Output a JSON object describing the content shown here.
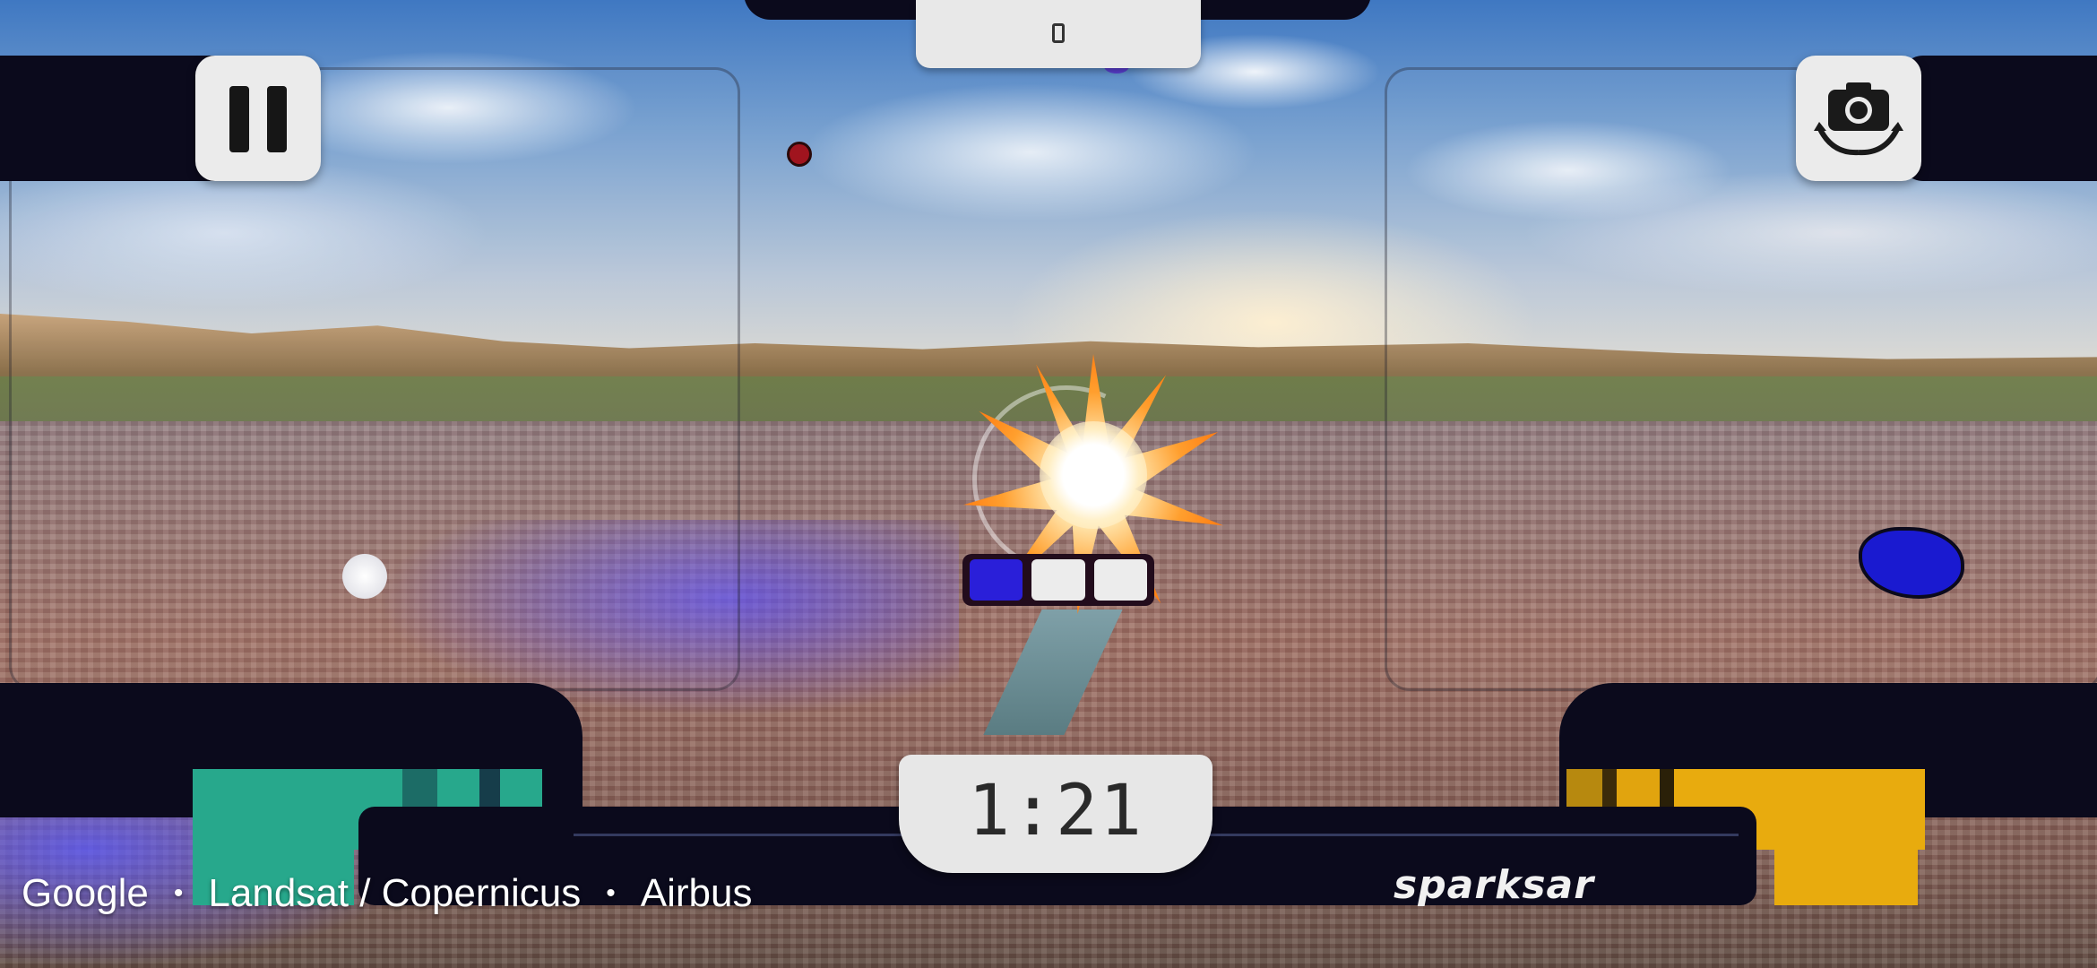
{
  "hud": {
    "timer": "1:21",
    "brand": "sparksar",
    "pause_icon": "pause-icon",
    "camera_icon": "camera-rotate-icon",
    "notch_icon": "phone-icon",
    "round_progress": [
      true,
      false,
      false
    ]
  },
  "attribution": {
    "items": [
      "Google",
      "Landsat / Copernicus",
      "Airbus"
    ],
    "separator": "•"
  },
  "colors": {
    "team_left": "#27a88c",
    "team_right": "#e8ab0e",
    "hud_dark": "#0b0a1c",
    "active_box": "#2a1fd9"
  }
}
